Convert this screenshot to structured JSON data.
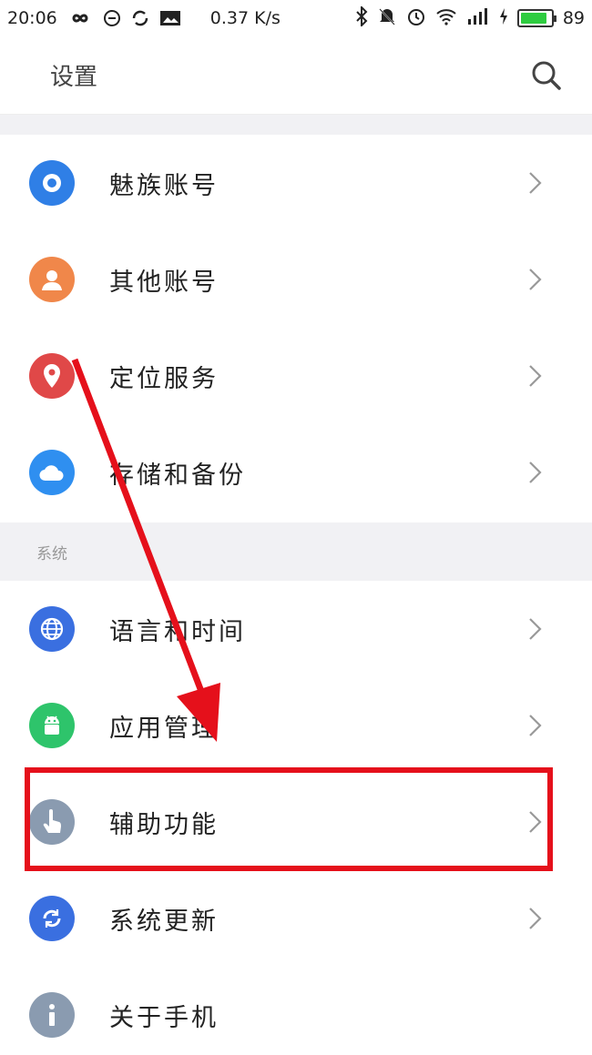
{
  "status_bar": {
    "time": "20:06",
    "net_speed": "0.37 K/s",
    "battery": "89",
    "battery_level": 0.89
  },
  "header": {
    "title": "设置"
  },
  "accounts": {
    "items": [
      {
        "label": "魅族账号",
        "icon": "flyme-account-icon",
        "color": "#2f7fe6"
      },
      {
        "label": "其他账号",
        "icon": "person-icon",
        "color": "#f0874a"
      },
      {
        "label": "定位服务",
        "icon": "location-pin-icon",
        "color": "#e04848"
      },
      {
        "label": "存储和备份",
        "icon": "cloud-icon",
        "color": "#2f8ff0"
      }
    ]
  },
  "system": {
    "section_title": "系统",
    "items": [
      {
        "label": "语言和时间",
        "icon": "globe-icon",
        "color": "#3a6fe0"
      },
      {
        "label": "应用管理",
        "icon": "android-icon",
        "color": "#2ec46b"
      },
      {
        "label": "辅助功能",
        "icon": "hand-pointer-icon",
        "color": "#8a9bb0"
      },
      {
        "label": "系统更新",
        "icon": "update-icon",
        "color": "#3a6fe0"
      },
      {
        "label": "关于手机",
        "icon": "info-icon",
        "color": "#8a9bb0"
      }
    ]
  },
  "annotation": {
    "highlight_color": "#e5101b"
  }
}
